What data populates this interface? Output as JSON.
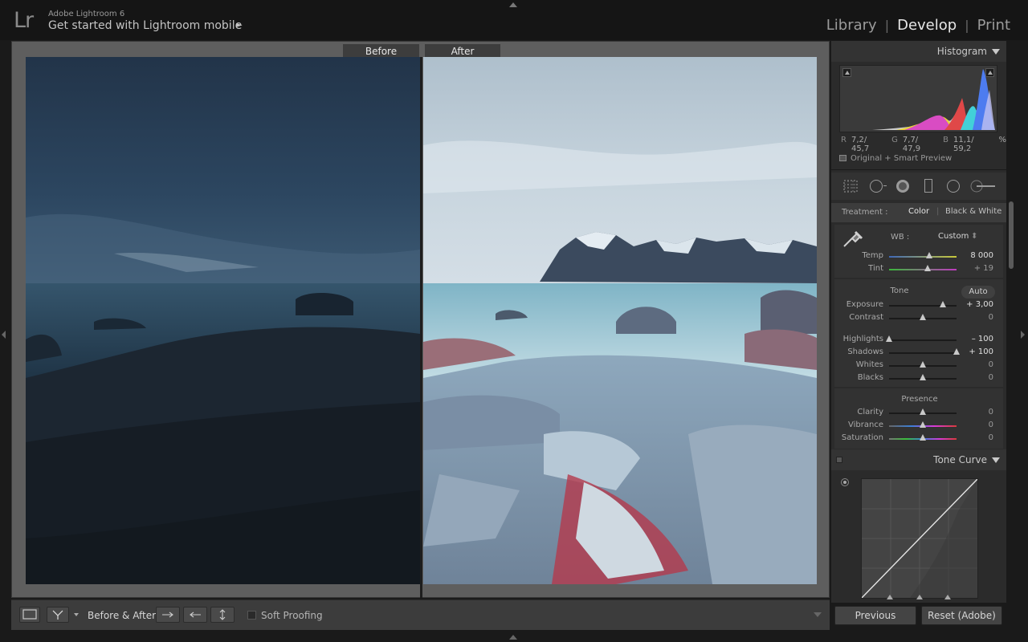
{
  "app": {
    "logo": "Lr",
    "name": "Adobe Lightroom 6",
    "mobile_prompt": "Get started with Lightroom mobile",
    "mobile_arrow": "►"
  },
  "modules": [
    {
      "label": "Library",
      "active": false
    },
    {
      "label": "Develop",
      "active": true
    },
    {
      "label": "Print",
      "active": false
    }
  ],
  "module_separator": "|",
  "view": {
    "before_label": "Before",
    "after_label": "After"
  },
  "toolbar": {
    "before_after_label": "Before & After :",
    "soft_proofing_label": "Soft Proofing"
  },
  "histogram": {
    "title": "Histogram",
    "r_key": "R",
    "r_val": "7,2/ 45,7",
    "g_key": "G",
    "g_val": "7,7/ 47,9",
    "b_key": "B",
    "b_val": "11,1/ 59,2",
    "unit": "%",
    "preview_status": "Original + Smart Preview"
  },
  "basic": {
    "treatment_label": "Treatment :",
    "treatment_color": "Color",
    "treatment_bw": "Black & White",
    "wb_label": "WB :",
    "wb_value": "Custom",
    "wb_chevron": "⬍",
    "temp": {
      "label": "Temp",
      "value": "8 000",
      "pos": 0.6
    },
    "tint": {
      "label": "Tint",
      "value": "+ 19",
      "pos": 0.57
    },
    "tone_title": "Tone",
    "auto_label": "Auto",
    "exposure": {
      "label": "Exposure",
      "value": "+ 3,00",
      "pos": 0.8
    },
    "contrast": {
      "label": "Contrast",
      "value": "0",
      "pos": 0.5
    },
    "highlights": {
      "label": "Highlights",
      "value": "– 100",
      "pos": 0.0
    },
    "shadows": {
      "label": "Shadows",
      "value": "+ 100",
      "pos": 1.0
    },
    "whites": {
      "label": "Whites",
      "value": "0",
      "pos": 0.5
    },
    "blacks": {
      "label": "Blacks",
      "value": "0",
      "pos": 0.5
    },
    "presence_title": "Presence",
    "clarity": {
      "label": "Clarity",
      "value": "0",
      "pos": 0.5
    },
    "vibrance": {
      "label": "Vibrance",
      "value": "0",
      "pos": 0.5
    },
    "saturation": {
      "label": "Saturation",
      "value": "0",
      "pos": 0.5
    }
  },
  "tone_curve": {
    "title": "Tone Curve"
  },
  "footer": {
    "previous_label": "Previous",
    "reset_label": "Reset (Adobe)"
  },
  "colors": {
    "accent_active": "#e6e6e6",
    "panel_bg": "#2b2b2b"
  }
}
